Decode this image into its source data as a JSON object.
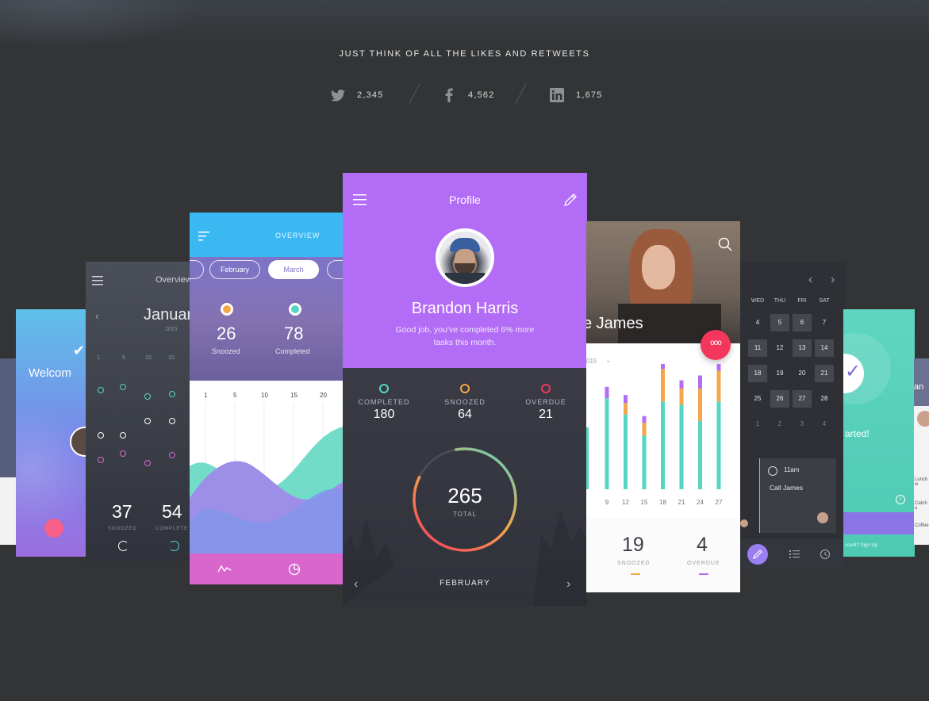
{
  "tagline": "JUST THINK OF ALL THE LIKES AND RETWEETS",
  "social": {
    "twitter": "2,345",
    "facebook": "4,562",
    "linkedin": "1,675"
  },
  "colors": {
    "profile_purple": "#b36cf5",
    "teal": "#55d6c2",
    "orange": "#f5a54a",
    "red": "#f5365c",
    "blue": "#3ab8f2",
    "pink": "#d866cc"
  },
  "welcome": {
    "title": "Welcom"
  },
  "overview_cal": {
    "title": "Overview",
    "month": "Januar",
    "year": "2015",
    "days": [
      "1",
      "5",
      "10",
      "15"
    ],
    "snoozed_value": "37",
    "snoozed_label": "SNOOZED",
    "completed_value": "54",
    "completed_label": "COMPLETE"
  },
  "chart_card": {
    "title": "OVERVIEW",
    "months": [
      "February",
      "March"
    ],
    "snoozed_value": "26",
    "snoozed_label": "Snoozed",
    "completed_value": "78",
    "completed_label": "Completed",
    "axis_days": [
      "1",
      "5",
      "10",
      "15",
      "20"
    ]
  },
  "profile": {
    "title": "Profile",
    "name": "Brandon Harris",
    "message_line1": "Good job, you've completed 6% more",
    "message_line2": "tasks this month.",
    "stats": [
      {
        "label": "COMPLETED",
        "value": "180",
        "color": "#55d6c2"
      },
      {
        "label": "SNOOZED",
        "value": "64",
        "color": "#f5a54a"
      },
      {
        "label": "OVERDUE",
        "value": "21",
        "color": "#f5365c"
      }
    ],
    "total_value": "265",
    "total_label": "TOTAL",
    "month": "FEBRUARY",
    "ring_fraction": 0.85
  },
  "james": {
    "name": "e James",
    "year": "015",
    "snoozed_value": "19",
    "snoozed_label": "SNOOZED",
    "overdue_value": "4",
    "overdue_label": "OVERDUE",
    "chart_data": {
      "type": "bar",
      "categories": [
        "9",
        "12",
        "15",
        "18",
        "21",
        "24",
        "27"
      ],
      "series": [
        {
          "name": "",
          "values": [
            5.6,
            4.6,
            3.3,
            5.4,
            5.2,
            4.2,
            5.4
          ]
        },
        {
          "name": "",
          "values": [
            0.0,
            0.7,
            0.8,
            2.0,
            1.0,
            2.0,
            1.9
          ]
        },
        {
          "name": "",
          "values": [
            0.7,
            0.5,
            0.4,
            0.5,
            0.5,
            0.8,
            0.7
          ]
        }
      ]
    }
  },
  "calendar": {
    "weekdays": [
      "WED",
      "THU",
      "FRI",
      "SAT"
    ],
    "rows": [
      [
        "4",
        "5",
        "6",
        "7"
      ],
      [
        "11",
        "12",
        "13",
        "14"
      ],
      [
        "18",
        "19",
        "20",
        "21"
      ],
      [
        "25",
        "26",
        "27",
        "28"
      ],
      [
        "1",
        "2",
        "3",
        "4"
      ]
    ],
    "event_time": "11am",
    "event_title": "Call James"
  },
  "started": {
    "text": "arted!",
    "signup": "count? Sign Up"
  },
  "farright": {
    "name": "an",
    "items": [
      "Lunch w",
      "Catch u",
      "Coffee"
    ]
  }
}
